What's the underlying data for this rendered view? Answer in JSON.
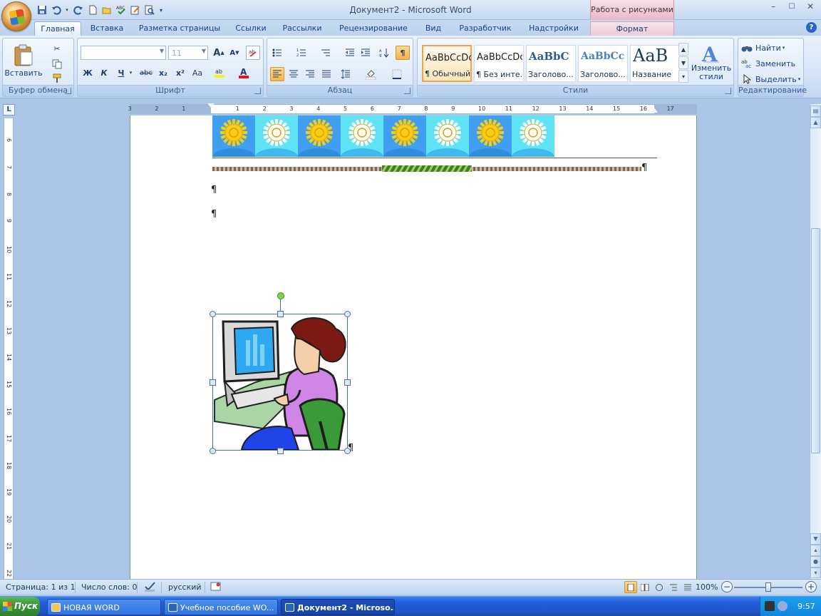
{
  "titlebar": {
    "title": "Документ2 - Microsoft Word",
    "context_title": "Работа с рисунками",
    "minimize": "–",
    "maximize": "☐",
    "close": "✕"
  },
  "qat": {
    "icons": [
      "save-icon",
      "undo-icon",
      "redo-icon",
      "new-doc-icon",
      "open-icon",
      "spellcheck-icon",
      "edit-icon",
      "print-preview-icon",
      "customize-icon"
    ]
  },
  "tabs": [
    {
      "label": "Главная",
      "active": true
    },
    {
      "label": "Вставка"
    },
    {
      "label": "Разметка страницы"
    },
    {
      "label": "Ссылки"
    },
    {
      "label": "Рассылки"
    },
    {
      "label": "Рецензирование"
    },
    {
      "label": "Вид"
    },
    {
      "label": "Разработчик"
    },
    {
      "label": "Надстройки"
    },
    {
      "label": "Формат",
      "context": true
    }
  ],
  "help": "?",
  "ribbon": {
    "clipboard": {
      "label": "Буфер обмена",
      "paste": "Вставить"
    },
    "font": {
      "label": "Шрифт",
      "font_name": "",
      "font_size": "11",
      "bold": "Ж",
      "italic": "К",
      "underline": "Ч",
      "strike": "abc",
      "sub": "x₂",
      "sup": "x²",
      "case": "Aa",
      "grow": "A",
      "shrink": "A"
    },
    "paragraph": {
      "label": "Абзац",
      "pilcrow": "¶"
    },
    "styles": {
      "label": "Стили",
      "tiles": [
        {
          "sample": "AaBbCcDc",
          "name": "¶ Обычный",
          "selected": true
        },
        {
          "sample": "AaBbCcDc",
          "name": "¶ Без инте..."
        },
        {
          "sample": "AaBbC",
          "name": "Заголово..."
        },
        {
          "sample": "AaBbCc",
          "name": "Заголово..."
        },
        {
          "sample": "AaB",
          "name": "Название"
        }
      ],
      "change": "Изменить стили"
    },
    "editing": {
      "label": "Редактирование",
      "find": "Найти",
      "replace": "Заменить",
      "select": "Выделить"
    }
  },
  "ruler": {
    "corner": "L",
    "h_ticks": [
      "3",
      "2",
      "1",
      "1",
      "2",
      "3",
      "4",
      "5",
      "6",
      "7",
      "8",
      "9",
      "10",
      "11",
      "12",
      "13",
      "14",
      "15",
      "16",
      "17"
    ],
    "v_ticks": [
      "6",
      "7",
      "8",
      "9",
      "10",
      "11",
      "12",
      "13",
      "14",
      "15",
      "16",
      "17",
      "18",
      "19",
      "20",
      "21",
      "22"
    ]
  },
  "document": {
    "pilcrow": "¶"
  },
  "status": {
    "page": "Страница: 1 из 1",
    "words": "Число слов: 0",
    "language": "русский",
    "zoom": "100%",
    "zoom_level_percent": 100
  },
  "taskbar": {
    "start": "Пуск",
    "items": [
      {
        "label": "НОВАЯ WORD"
      },
      {
        "label": "Учебное пособие WO..."
      },
      {
        "label": "Документ2 - Microso...",
        "active": true
      }
    ],
    "clock": "9:57"
  },
  "colors": {
    "sun_tile_dark": "#3f9ff1",
    "sun_tile_light": "#5fe3f5",
    "sun": "#f7cc12"
  }
}
